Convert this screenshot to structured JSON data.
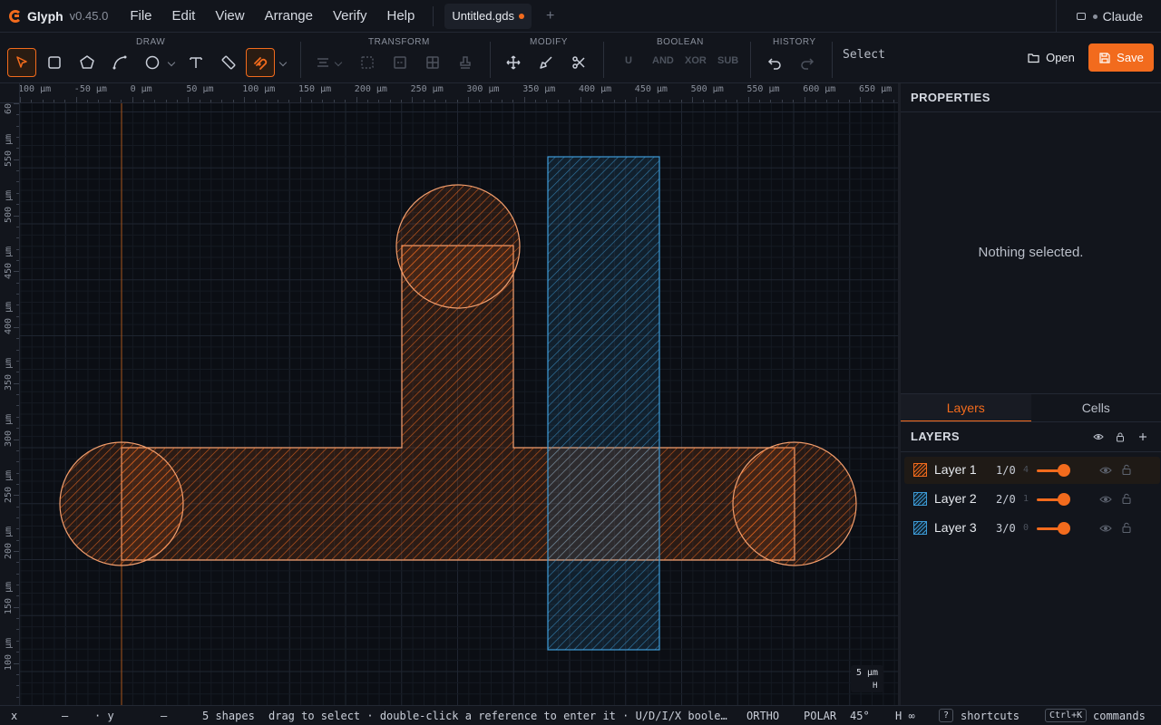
{
  "app": {
    "name": "Glyph",
    "version": "v0.45.0"
  },
  "menu": [
    "File",
    "Edit",
    "View",
    "Arrange",
    "Verify",
    "Help"
  ],
  "tab": {
    "filename": "Untitled.gds"
  },
  "user": {
    "name": "Claude"
  },
  "toolbar": {
    "groups": {
      "draw": "DRAW",
      "transform": "TRANSFORM",
      "modify": "MODIFY",
      "boolean": "BOOLEAN",
      "history": "HISTORY"
    },
    "boolean_ops": [
      "U",
      "AND",
      "XOR",
      "SUB"
    ],
    "mode": "Select",
    "open_label": "Open",
    "save_label": "Save",
    "tools": [
      "select-icon",
      "rectangle-icon",
      "polygon-icon",
      "path-icon",
      "circle-icon",
      "text-icon",
      "ruler-icon",
      "snap-magnet-icon",
      "align-icon",
      "group-icon",
      "ungroup-icon",
      "array-icon",
      "stamp-icon",
      "move-icon",
      "brush-icon",
      "scissors-icon",
      "undo-icon",
      "redo-icon"
    ]
  },
  "ruler": {
    "top": [
      "100 µm",
      "-50 µm",
      "0 µm",
      "50 µm",
      "100 µm",
      "150 µm",
      "200 µm",
      "250 µm",
      "300 µm",
      "350 µm",
      "400 µm",
      "450 µm",
      "500 µm",
      "550 µm",
      "600 µm",
      "650 µm"
    ],
    "left": [
      "60",
      "550 µm",
      "500 µm",
      "450 µm",
      "400 µm",
      "350 µm",
      "300 µm",
      "250 µm",
      "200 µm",
      "150 µm",
      "100 µm"
    ]
  },
  "canvas": {
    "scale_value": "5 µm",
    "scale_hint": "H"
  },
  "colors": {
    "accent": "#f26b1d",
    "layer1": "#f2a070",
    "layer2": "#3d9ad6",
    "background": "#0b0e14"
  },
  "properties": {
    "title": "PROPERTIES",
    "empty": "Nothing selected."
  },
  "panel_tabs": [
    "Layers",
    "Cells"
  ],
  "layers": {
    "title": "LAYERS",
    "items": [
      {
        "name": "Layer 1",
        "id": "1/0",
        "count": "4",
        "color": "#f26b1d"
      },
      {
        "name": "Layer 2",
        "id": "2/0",
        "count": "1",
        "color": "#3d9ad6"
      },
      {
        "name": "Layer 3",
        "id": "3/0",
        "count": "0",
        "color": "#3d9ad6"
      }
    ]
  },
  "status": {
    "x_label": "x",
    "x_val": "—",
    "y_label": "· y",
    "y_val": "—",
    "shapes": "5 shapes",
    "hint": "drag to select · double-click a reference to enter it · U/D/I/X boole…",
    "ortho": "ORTHO",
    "polar": "POLAR",
    "angle": "45°",
    "h": "H ∞",
    "shortcuts_key": "?",
    "shortcuts": "shortcuts",
    "commands_key": "Ctrl+K",
    "commands": "commands"
  }
}
